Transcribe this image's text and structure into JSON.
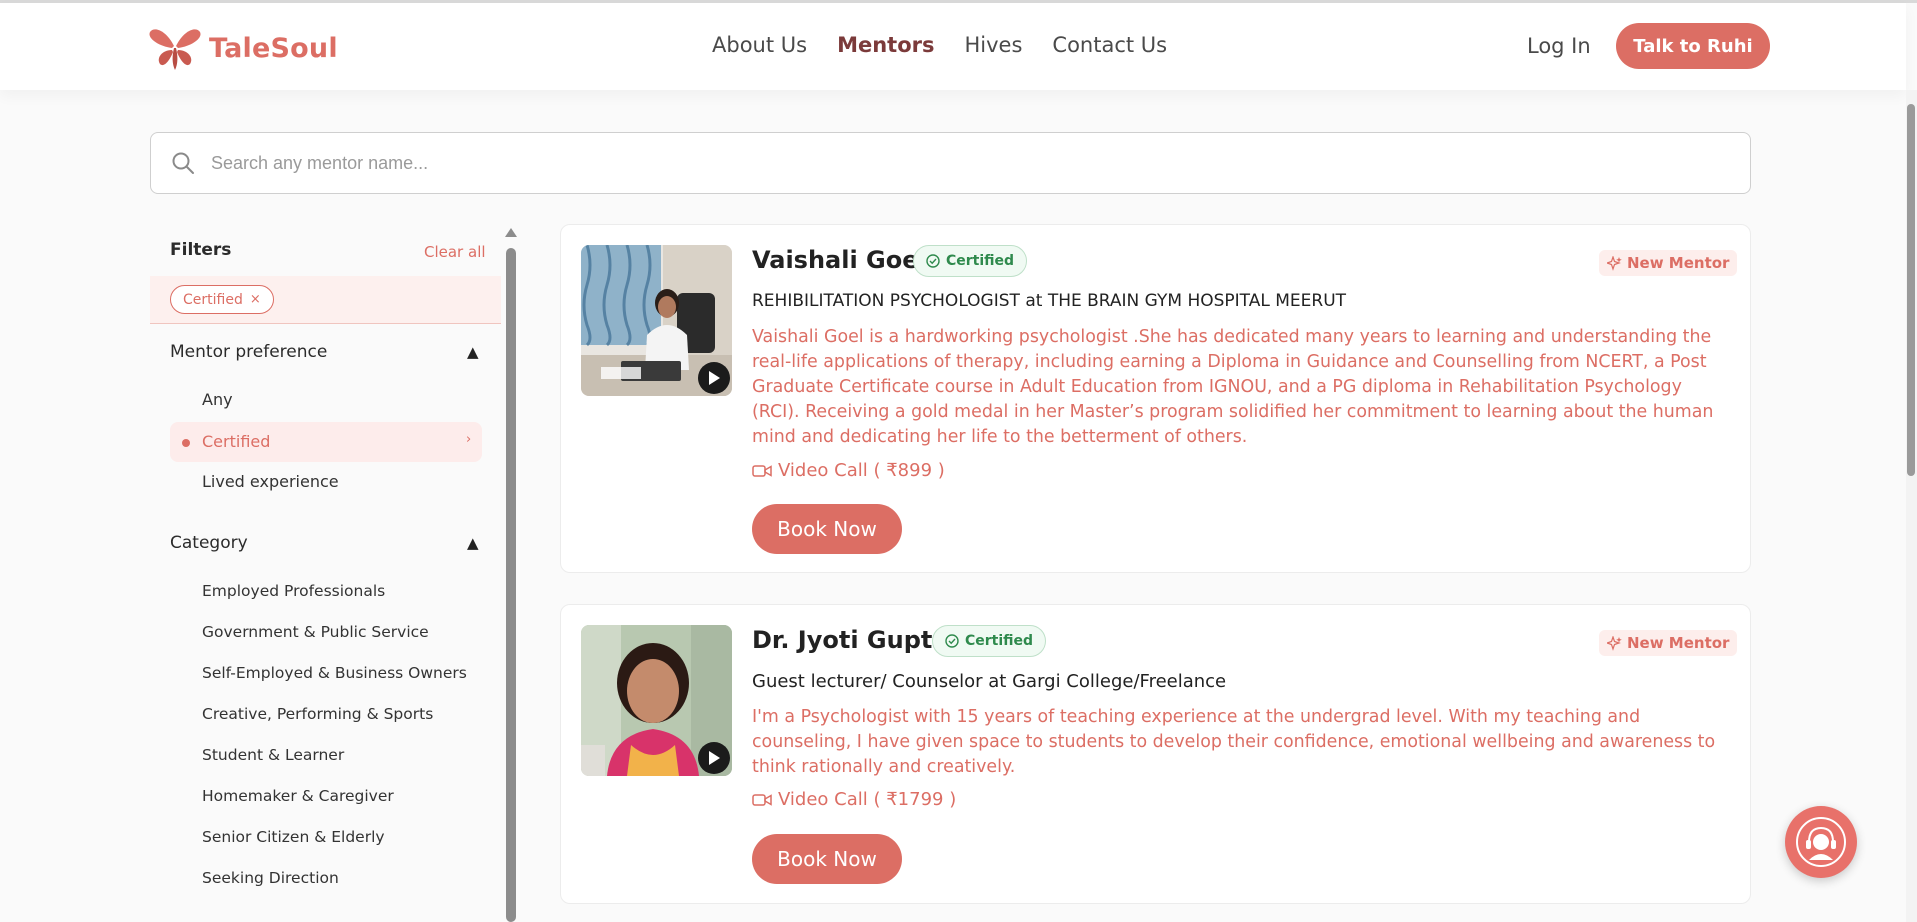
{
  "header": {
    "brand": "TaleSoul",
    "nav": [
      "About Us",
      "Mentors",
      "Hives",
      "Contact Us"
    ],
    "active_nav": "Mentors",
    "login": "Log In",
    "cta": "Talk to Ruhi"
  },
  "search": {
    "placeholder": "Search any mentor name..."
  },
  "filters": {
    "title": "Filters",
    "clear": "Clear all",
    "chips": [
      "Certified"
    ],
    "chip_close": "×",
    "mentor_preference": {
      "title": "Mentor preference",
      "toggle": "▲",
      "options": [
        "Any",
        "Certified",
        "Lived experience"
      ],
      "selected": "Certified",
      "selected_chevron": "›"
    },
    "category": {
      "title": "Category",
      "toggle": "▲",
      "options": [
        "Employed Professionals",
        "Government & Public Service",
        "Self-Employed & Business Owners",
        "Creative, Performing & Sports",
        "Student & Learner",
        "Homemaker & Caregiver",
        "Senior Citizen & Elderly",
        "Seeking Direction"
      ]
    }
  },
  "mentors": [
    {
      "name": "Vaishali Goel",
      "badge": "Certified",
      "tag": "New Mentor",
      "role": "REHIBILITATION PSYCHOLOGIST at THE BRAIN GYM HOSPITAL MEERUT",
      "description": "Vaishali Goel is a hardworking psychologist .She has dedicated many years to learning and understanding the real-life applications of therapy, including earning a Diploma in Guidance and Counselling from NCERT, a Post Graduate Certificate course in Adult Education from IGNOU, and a PG diploma in Rehabilitation Psychology (RCI). Receiving a gold medal in her Master’s program solidified her commitment to learning about the human mind and dedicating her life to the betterment of others.",
      "call": "Video Call ( ₹899 )",
      "cta": "Book Now"
    },
    {
      "name": "Dr. Jyoti Gupta",
      "badge": "Certified",
      "tag": "New Mentor",
      "role": "Guest lecturer/ Counselor at Gargi College/Freelance",
      "description": "I'm a Psychologist with 15 years of teaching experience at the undergrad level. With my teaching and counseling, I have given space to students to develop their confidence, emotional wellbeing and awareness to think rationally and creatively.",
      "call": "Video Call ( ₹1799 )",
      "cta": "Book Now"
    }
  ],
  "colors": {
    "accent": "#dc6e64",
    "nav_active": "#7b3a3a",
    "certified": "#2f8a4d"
  }
}
